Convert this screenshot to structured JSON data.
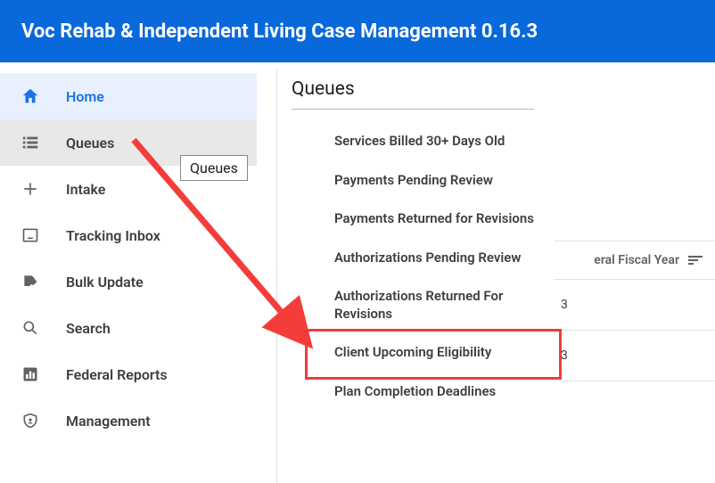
{
  "header": {
    "title": "Voc Rehab & Independent Living Case Management 0.16.3"
  },
  "sidebar": {
    "items": [
      {
        "label": "Home",
        "icon": "home"
      },
      {
        "label": "Queues",
        "icon": "list",
        "tooltip": "Queues"
      },
      {
        "label": "Intake",
        "icon": "plus"
      },
      {
        "label": "Tracking Inbox",
        "icon": "inbox"
      },
      {
        "label": "Bulk Update",
        "icon": "edit-doc"
      },
      {
        "label": "Search",
        "icon": "search"
      },
      {
        "label": "Federal Reports",
        "icon": "bar-chart"
      },
      {
        "label": "Management",
        "icon": "shield"
      }
    ]
  },
  "submenu": {
    "title": "Queues",
    "items": [
      "Services Billed 30+ Days Old",
      "Payments Pending Review",
      "Payments Returned for Revisions",
      "Authorizations Pending Review",
      "Authorizations Returned For Revisions",
      "Client Upcoming Eligibility",
      "Plan Completion Deadlines"
    ]
  },
  "right": {
    "column_label": "eral Fiscal Year",
    "rows": [
      "3",
      "3"
    ]
  }
}
